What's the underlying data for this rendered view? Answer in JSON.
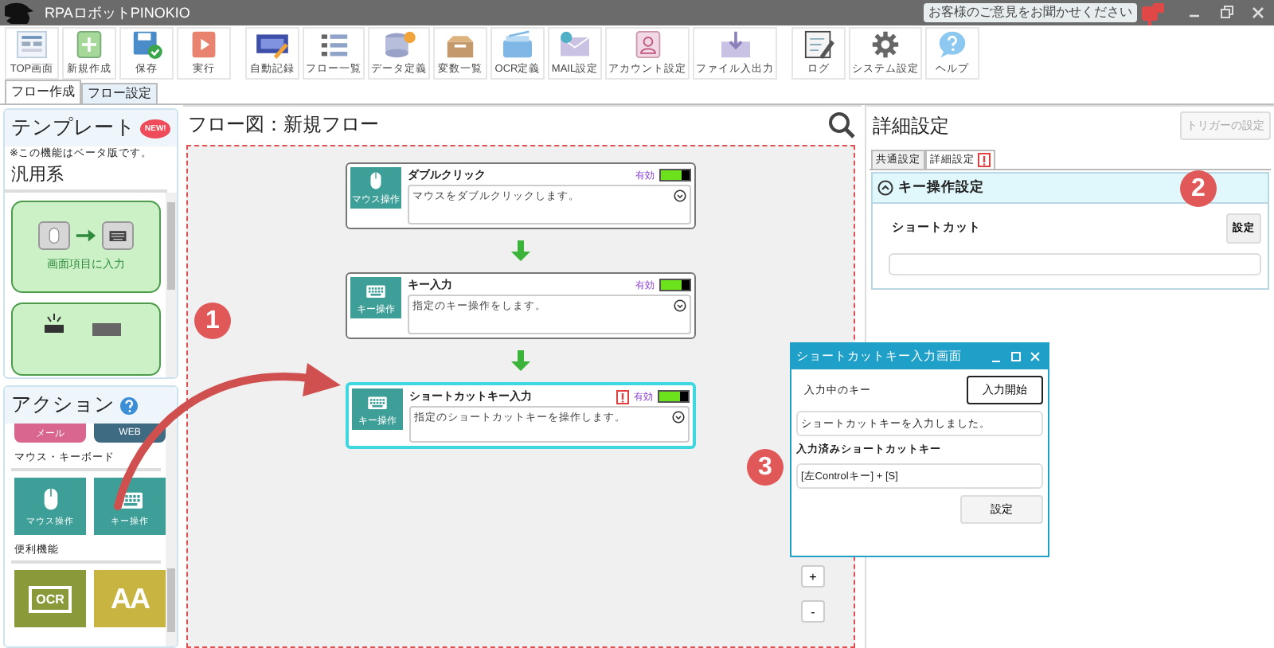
{
  "window": {
    "title": "RPAロボットPINOKIO",
    "feedback": "お客様のご意見をお聞かせください"
  },
  "toolbar": {
    "groups": [
      {
        "buttons": [
          {
            "kind": "top",
            "label": "TOP画面"
          },
          {
            "kind": "new",
            "label": "新規作成"
          },
          {
            "kind": "save",
            "label": "保存"
          },
          {
            "kind": "run",
            "label": "実行"
          }
        ]
      },
      {
        "buttons": [
          {
            "kind": "record",
            "label": "自動記録"
          },
          {
            "kind": "flows",
            "label": "フロー一覧"
          },
          {
            "kind": "data",
            "label": "データ定義"
          },
          {
            "kind": "vars",
            "label": "変数一覧"
          },
          {
            "kind": "ocr",
            "label": "OCR定義"
          },
          {
            "kind": "mail",
            "label": "MAIL設定"
          },
          {
            "kind": "account",
            "label": "アカウント設定"
          },
          {
            "kind": "file",
            "label": "ファイル入出力"
          }
        ]
      },
      {
        "buttons": [
          {
            "kind": "log",
            "label": "ログ"
          },
          {
            "kind": "settings",
            "label": "システム設定"
          },
          {
            "kind": "help",
            "label": "ヘルプ"
          }
        ]
      }
    ]
  },
  "tabs": [
    {
      "label": "フロー作成",
      "selected": true
    },
    {
      "label": "フロー設定",
      "selected": false
    }
  ],
  "template_panel": {
    "title": "テンプレート",
    "badge": "NEW!",
    "note": "※この機能はベータ版です。",
    "category": "汎用系",
    "cards": [
      {
        "label": "画面項目に入力"
      }
    ]
  },
  "action_panel": {
    "title": "アクション",
    "top_tiles": [
      {
        "kind": "mail",
        "label": "メール"
      },
      {
        "kind": "web",
        "label": "WEB"
      }
    ],
    "groups": [
      {
        "title": "マウス・キーボード",
        "tiles": [
          {
            "kind": "mouse",
            "label": "マウス操作"
          },
          {
            "kind": "keyboard",
            "label": "キー操作"
          }
        ]
      },
      {
        "title": "便利機能",
        "tiles": [
          {
            "kind": "ocr",
            "label": "OCR"
          },
          {
            "kind": "text",
            "label": "AA"
          }
        ]
      }
    ]
  },
  "flow": {
    "title": "フロー図：新規フロー",
    "marker": "1",
    "nodes": [
      {
        "kind": "mouse",
        "icon_label": "マウス操作",
        "title": "ダブルクリック",
        "status": "有効",
        "enabled": true,
        "warning": false,
        "selected": false,
        "description": "マウスをダブルクリックします。"
      },
      {
        "kind": "keyboard",
        "icon_label": "キー操作",
        "title": "キー入力",
        "status": "有効",
        "enabled": true,
        "warning": false,
        "selected": false,
        "description": "指定のキー操作をします。"
      },
      {
        "kind": "keyboard",
        "icon_label": "キー操作",
        "title": "ショートカットキー入力",
        "status": "有効",
        "enabled": true,
        "warning": true,
        "selected": true,
        "description": "指定のショートカットキーを操作します。"
      }
    ],
    "zoom_buttons": [
      "+",
      "-"
    ]
  },
  "detail": {
    "title": "詳細設定",
    "trigger_button": {
      "label": "トリガーの設定",
      "disabled": true
    },
    "marker": "2",
    "tabs": [
      {
        "label": "共通設定",
        "selected": false,
        "warning": false
      },
      {
        "label": "詳細設定",
        "selected": true,
        "warning": true
      }
    ],
    "section": {
      "title": "キー操作設定",
      "expanded": true,
      "field_label": "ショートカット",
      "button": "設定"
    }
  },
  "dialog": {
    "title": "ショートカットキー入力画面",
    "marker": "3",
    "current_label": "入力中のキー",
    "start_button": "入力開始",
    "message": "ショートカットキーを入力しました。",
    "entered_label": "入力済みショートカットキー",
    "entered_value": "[左Controlキー] + [S]",
    "set_button": "設定"
  }
}
